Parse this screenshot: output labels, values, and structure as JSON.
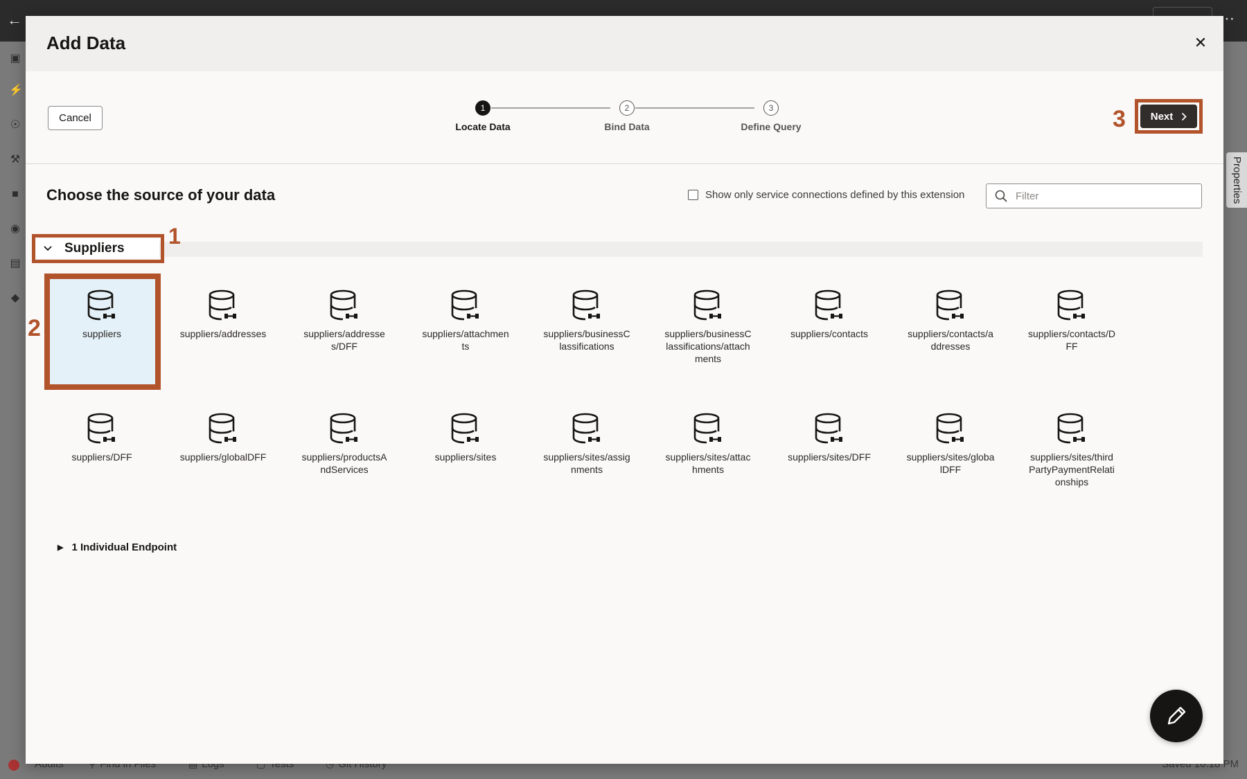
{
  "background": {
    "bottom_bar": [
      {
        "label": "Audits",
        "icon": "audits-icon"
      },
      {
        "label": "Find in Files",
        "icon": "search-icon"
      },
      {
        "label": "Logs",
        "icon": "logs-icon"
      },
      {
        "label": "Tests",
        "icon": "tests-icon"
      },
      {
        "label": "Git History",
        "icon": "history-icon"
      }
    ],
    "saved_status": "Saved 10:18 PM",
    "properties_tab": "Properties"
  },
  "dialog": {
    "title": "Add Data",
    "close_icon": "close-icon",
    "cancel_label": "Cancel",
    "next_label": "Next",
    "steps": [
      {
        "number": "1",
        "label": "Locate Data",
        "state": "active"
      },
      {
        "number": "2",
        "label": "Bind Data",
        "state": "inactive"
      },
      {
        "number": "3",
        "label": "Define Query",
        "state": "inactive"
      }
    ],
    "section_title": "Choose the source of your data",
    "checkbox_label": "Show only service connections defined by this extension",
    "checkbox_checked": false,
    "filter_placeholder": "Filter",
    "group": {
      "name": "Suppliers",
      "expanded": true,
      "items": [
        {
          "label": "suppliers",
          "selected": true
        },
        {
          "label": "suppliers/addresses"
        },
        {
          "label": "suppliers/addresses/DFF"
        },
        {
          "label": "suppliers/attachments"
        },
        {
          "label": "suppliers/businessClassifications"
        },
        {
          "label": "suppliers/businessClassifications/attachments"
        },
        {
          "label": "suppliers/contacts"
        },
        {
          "label": "suppliers/contacts/addresses"
        },
        {
          "label": "suppliers/contacts/DFF"
        },
        {
          "label": "suppliers/DFF"
        },
        {
          "label": "suppliers/globalDFF"
        },
        {
          "label": "suppliers/productsAndServices"
        },
        {
          "label": "suppliers/sites"
        },
        {
          "label": "suppliers/sites/assignments"
        },
        {
          "label": "suppliers/sites/attachments"
        },
        {
          "label": "suppliers/sites/DFF"
        },
        {
          "label": "suppliers/sites/globalDFF"
        },
        {
          "label": "suppliers/sites/thirdPartyPaymentRelationships"
        }
      ]
    },
    "endpoint_label": "1 Individual Endpoint",
    "fab_icon": "edit-pencil-icon"
  },
  "annotations": [
    "1",
    "2",
    "3"
  ],
  "colors": {
    "annotation": "#b1532b",
    "primary_button": "#312d2a",
    "selected_tile": "#e4f1f8"
  }
}
